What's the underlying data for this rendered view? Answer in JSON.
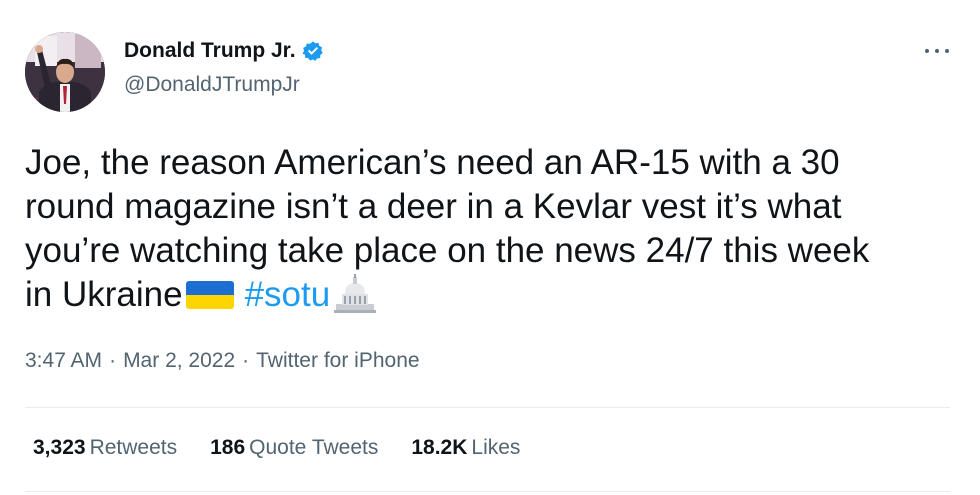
{
  "author": {
    "display_name": "Donald Trump Jr.",
    "handle": "@DonaldJTrumpJr",
    "verified": true,
    "avatar_icon": "profile-photo"
  },
  "tweet": {
    "lines": [
      "Joe, the reason American’s need an AR-15 with a 30",
      "round magazine isn’t a deer in a Kevlar vest it’s what",
      "you’re watching take place on the news 24/7 this week",
      "in Ukraine"
    ],
    "emoji_flag": "ukraine-flag-emoji",
    "hashtag": "#sotu",
    "emoji_capitol": "us-capitol-emoji"
  },
  "meta": {
    "time": "3:47 AM",
    "separator": "·",
    "date": "Mar 2, 2022",
    "source": "Twitter for iPhone"
  },
  "stats": {
    "retweets_count": "3,323",
    "retweets_label": "Retweets",
    "quotes_count": "186",
    "quotes_label": "Quote Tweets",
    "likes_count": "18.2K",
    "likes_label": "Likes"
  },
  "colors": {
    "text": "#0f1419",
    "secondary": "#536471",
    "link": "#1d9bf0",
    "verified": "#1d9bf0",
    "divider": "#e6ecf0"
  }
}
